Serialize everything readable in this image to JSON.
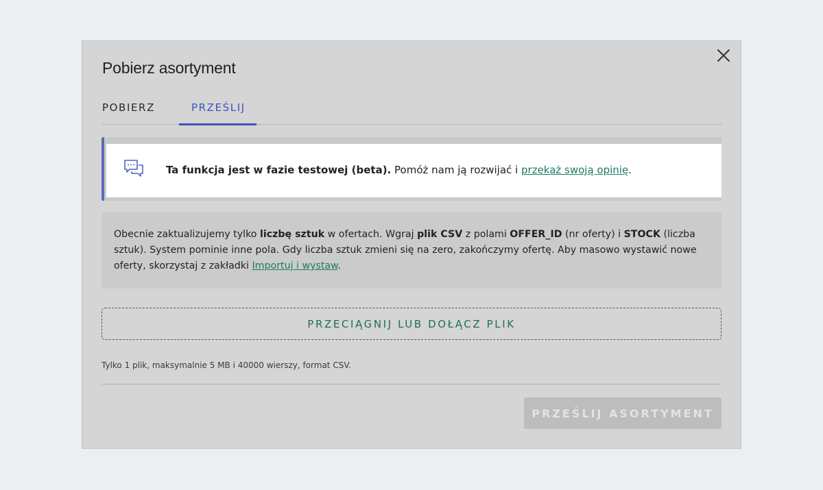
{
  "modal": {
    "title": "Pobierz asortyment",
    "close_icon": "close-icon"
  },
  "tabs": [
    {
      "label": "POBIERZ",
      "active": false
    },
    {
      "label": "PRZEŚLIJ",
      "active": true
    }
  ],
  "alert": {
    "icon": "chat-bubbles-icon",
    "bold_text": "Ta funkcja jest w fazie testowej (beta).",
    "text": " Pomóż nam ją rozwijać i ",
    "link_text": "przekaż swoją opinię",
    "suffix": "."
  },
  "info": {
    "p1": "Obecnie zaktualizujemy tylko ",
    "b1": "liczbę sztuk",
    "p2": " w ofertach. Wgraj ",
    "b2": "plik CSV",
    "p3": " z polami ",
    "b3": "OFFER_ID",
    "p4": " (nr oferty) i ",
    "b4": "STOCK",
    "p5": " (liczba sztuk). System pominie inne pola. Gdy liczba sztuk zmieni się na zero, zakończymy ofertę. Aby masowo wystawić nowe oferty, skorzystaj z zakładki ",
    "link_text": "Importuj i wystaw",
    "p6": "."
  },
  "dropzone": {
    "label": "PRZECIĄGNIJ LUB DOŁĄCZ PLIK"
  },
  "hint": "Tylko 1 plik, maksymalnie 5 MB i 40000 wierszy, format CSV.",
  "submit": {
    "label": "PRZEŚLIJ ASORTYMENT",
    "disabled": true
  },
  "colors": {
    "accent": "#3b56b8",
    "link": "#1f7a66",
    "overlay": "#d5d5d5"
  }
}
